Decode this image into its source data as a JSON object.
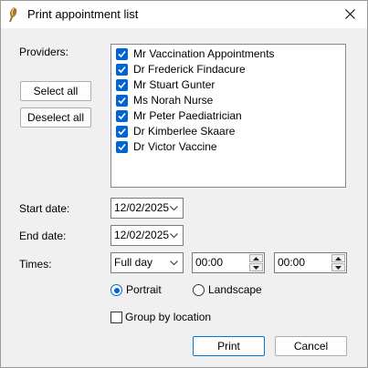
{
  "window": {
    "title": "Print appointment list"
  },
  "providers": {
    "label": "Providers:",
    "select_all": "Select all",
    "deselect_all": "Deselect all",
    "items": [
      {
        "label": "Mr Vaccination Appointments",
        "checked": true
      },
      {
        "label": "Dr Frederick Findacure",
        "checked": true
      },
      {
        "label": "Mr Stuart Gunter",
        "checked": true
      },
      {
        "label": "Ms Norah Nurse",
        "checked": true
      },
      {
        "label": "Mr Peter Paediatrician",
        "checked": true
      },
      {
        "label": "Dr Kimberlee Skaare",
        "checked": true
      },
      {
        "label": "Dr Victor Vaccine",
        "checked": true
      }
    ]
  },
  "start_date": {
    "label": "Start date:",
    "value": "12/02/2025"
  },
  "end_date": {
    "label": "End date:",
    "value": "12/02/2025"
  },
  "times": {
    "label": "Times:",
    "range": "Full day",
    "from": "00:00",
    "to": "00:00"
  },
  "orientation": {
    "portrait": "Portrait",
    "landscape": "Landscape",
    "selected": "Portrait"
  },
  "group_by_location": {
    "label": "Group by location",
    "checked": false
  },
  "buttons": {
    "print": "Print",
    "cancel": "Cancel"
  }
}
